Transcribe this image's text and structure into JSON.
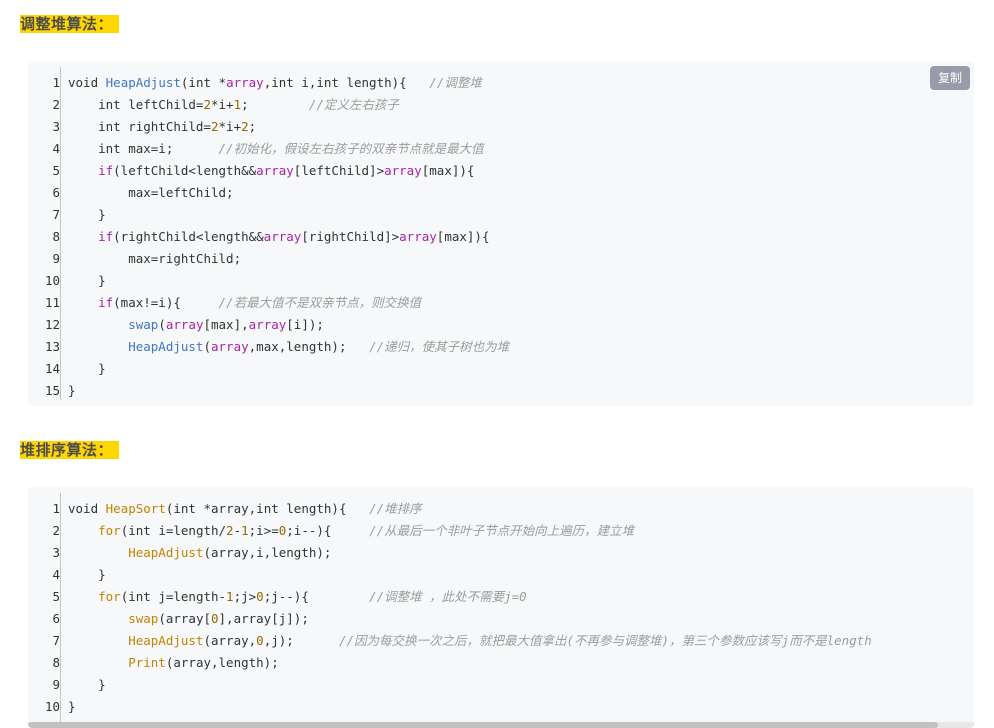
{
  "sections": [
    {
      "heading": "调整堆算法：",
      "copy_label": "复制",
      "line_numbers": [
        "1",
        "2",
        "3",
        "4",
        "5",
        "6",
        "7",
        "8",
        "9",
        "10",
        "11",
        "12",
        "13",
        "14",
        "15"
      ],
      "lines": [
        [
          [
            "kw",
            "void "
          ],
          [
            "fn",
            "HeapAdjust"
          ],
          [
            "kw",
            "(int *"
          ],
          [
            "arr-p",
            "array"
          ],
          [
            "kw",
            ",int i,int length){   "
          ],
          [
            "cmt",
            "//调整堆"
          ]
        ],
        [
          [
            "kw",
            "    int leftChild="
          ],
          [
            "num",
            "2"
          ],
          [
            "kw",
            "*i+"
          ],
          [
            "num",
            "1"
          ],
          [
            "kw",
            ";        "
          ],
          [
            "cmt",
            "//定义左右孩子"
          ]
        ],
        [
          [
            "kw",
            "    int rightChild="
          ],
          [
            "num",
            "2"
          ],
          [
            "kw",
            "*i+"
          ],
          [
            "num",
            "2"
          ],
          [
            "kw",
            ";"
          ]
        ],
        [
          [
            "kw",
            "    int max=i;      "
          ],
          [
            "cmt",
            "//初始化，假设左右孩子的双亲节点就是最大值"
          ]
        ],
        [
          [
            "kw2",
            "    if"
          ],
          [
            "kw",
            "(leftChild<length&&"
          ],
          [
            "arr-p",
            "array"
          ],
          [
            "kw",
            "[leftChild]>"
          ],
          [
            "arr-p",
            "array"
          ],
          [
            "kw",
            "[max]){"
          ]
        ],
        [
          [
            "kw",
            "        max=leftChild;"
          ]
        ],
        [
          [
            "kw",
            "    }"
          ]
        ],
        [
          [
            "kw2",
            "    if"
          ],
          [
            "kw",
            "(rightChild<length&&"
          ],
          [
            "arr-p",
            "array"
          ],
          [
            "kw",
            "[rightChild]>"
          ],
          [
            "arr-p",
            "array"
          ],
          [
            "kw",
            "[max]){"
          ]
        ],
        [
          [
            "kw",
            "        max=rightChild;"
          ]
        ],
        [
          [
            "kw",
            "    }"
          ]
        ],
        [
          [
            "kw2",
            "    if"
          ],
          [
            "kw",
            "(max!=i){     "
          ],
          [
            "cmt",
            "//若最大值不是双亲节点，则交换值"
          ]
        ],
        [
          [
            "fn",
            "        swap"
          ],
          [
            "kw",
            "("
          ],
          [
            "arr-p",
            "array"
          ],
          [
            "kw",
            "[max],"
          ],
          [
            "arr-p",
            "array"
          ],
          [
            "kw",
            "[i]);"
          ]
        ],
        [
          [
            "fn",
            "        HeapAdjust"
          ],
          [
            "kw",
            "("
          ],
          [
            "arr-p",
            "array"
          ],
          [
            "kw",
            ",max,length);   "
          ],
          [
            "cmt",
            "//递归，使其子树也为堆"
          ]
        ],
        [
          [
            "kw",
            "    }"
          ]
        ],
        [
          [
            "kw",
            "}"
          ]
        ]
      ]
    },
    {
      "heading": "堆排序算法：",
      "line_numbers": [
        "1",
        "2",
        "3",
        "4",
        "5",
        "6",
        "7",
        "8",
        "9",
        "10"
      ],
      "lines": [
        [
          [
            "kw",
            "void "
          ],
          [
            "fn2",
            "HeapSort"
          ],
          [
            "kw",
            "(int *array,int length){   "
          ],
          [
            "cmt",
            "//堆排序"
          ]
        ],
        [
          [
            "kw3",
            "    for"
          ],
          [
            "kw",
            "(int i=length/"
          ],
          [
            "num",
            "2"
          ],
          [
            "kw",
            "-"
          ],
          [
            "num",
            "1"
          ],
          [
            "kw",
            ";i>="
          ],
          [
            "num",
            "0"
          ],
          [
            "kw",
            ";i--){     "
          ],
          [
            "cmt",
            "//从最后一个非叶子节点开始向上遍历，建立堆"
          ]
        ],
        [
          [
            "fn2",
            "        HeapAdjust"
          ],
          [
            "kw",
            "(array,i,length);"
          ]
        ],
        [
          [
            "kw",
            "    }"
          ]
        ],
        [
          [
            "kw3",
            "    for"
          ],
          [
            "kw",
            "(int j=length-"
          ],
          [
            "num",
            "1"
          ],
          [
            "kw",
            ";j>"
          ],
          [
            "num",
            "0"
          ],
          [
            "kw",
            ";j--){        "
          ],
          [
            "cmt",
            "//调整堆 ，此处不需要j=0"
          ]
        ],
        [
          [
            "fn2",
            "        swap"
          ],
          [
            "kw",
            "(array["
          ],
          [
            "num",
            "0"
          ],
          [
            "kw",
            "],array[j]);"
          ]
        ],
        [
          [
            "fn2",
            "        HeapAdjust"
          ],
          [
            "kw",
            "(array,"
          ],
          [
            "num",
            "0"
          ],
          [
            "kw",
            ",j);      "
          ],
          [
            "cmt",
            "//因为每交换一次之后，就把最大值拿出(不再参与调整堆)，第三个参数应该写j而不是length"
          ]
        ],
        [
          [
            "fn2",
            "        Print"
          ],
          [
            "kw",
            "(array,length);"
          ]
        ],
        [
          [
            "kw",
            "    }"
          ]
        ],
        [
          [
            "kw",
            "}"
          ]
        ]
      ]
    }
  ]
}
